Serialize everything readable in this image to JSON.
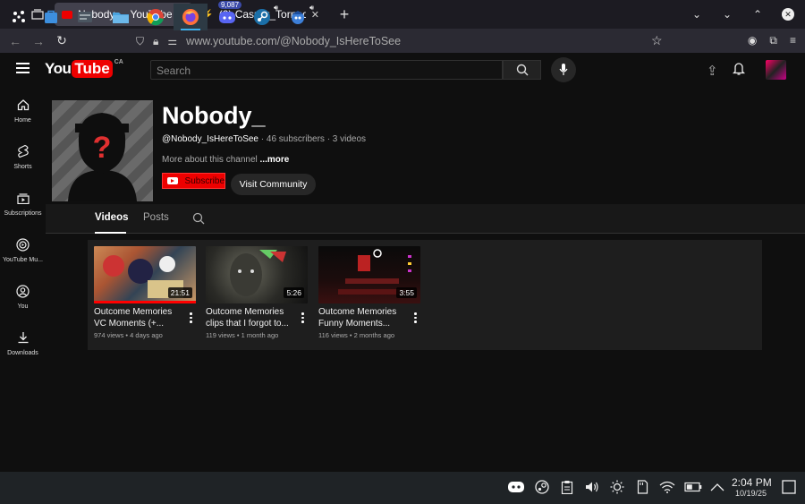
{
  "browser": {
    "tabs": [
      {
        "title": "Nobody_ - YouTube",
        "active": true
      },
      {
        "title": "(2) Casper_Tornado999 |",
        "active": false
      }
    ],
    "url": "www.youtube.com/@Nobody_IsHereToSee"
  },
  "youtube": {
    "logo_you": "You",
    "logo_tube": "Tube",
    "logo_country": "CA",
    "search_placeholder": "Search",
    "sidebar": [
      {
        "label": "Home",
        "icon": "home-icon"
      },
      {
        "label": "Shorts",
        "icon": "shorts-icon"
      },
      {
        "label": "Subscriptions",
        "icon": "subscriptions-icon"
      },
      {
        "label": "YouTube Mu...",
        "icon": "youtube-music-icon"
      },
      {
        "label": "You",
        "icon": "you-icon"
      },
      {
        "label": "Downloads",
        "icon": "downloads-icon"
      }
    ],
    "channel": {
      "name": "Nobody_",
      "handle": "@Nobody_IsHereToSee",
      "stats": " · 46 subscribers · 3 videos",
      "about": "More about this channel ",
      "more": "...more",
      "subscribe_label": "Subscribe",
      "community_label": "Visit Community"
    },
    "tabs": [
      "Videos",
      "Posts"
    ],
    "videos": [
      {
        "title": "Outcome Memories VC Moments (+...",
        "meta": "974 views • 4 days ago",
        "duration": "21:51",
        "watched": 1.0
      },
      {
        "title": "Outcome Memories clips that I forgot to...",
        "meta": "119 views • 1 month ago",
        "duration": "5:26",
        "watched": 0
      },
      {
        "title": "Outcome Memories Funny Moments...",
        "meta": "116 views • 2 months ago",
        "duration": "3:55",
        "watched": 0
      }
    ]
  },
  "taskbar": {
    "discord_badge": "9,087",
    "time": "2:04 PM",
    "date": "10/19/25"
  },
  "colors": {
    "accent": "#ff0000",
    "bg": "#0f0f0f",
    "taskbar": "#1f2326"
  }
}
